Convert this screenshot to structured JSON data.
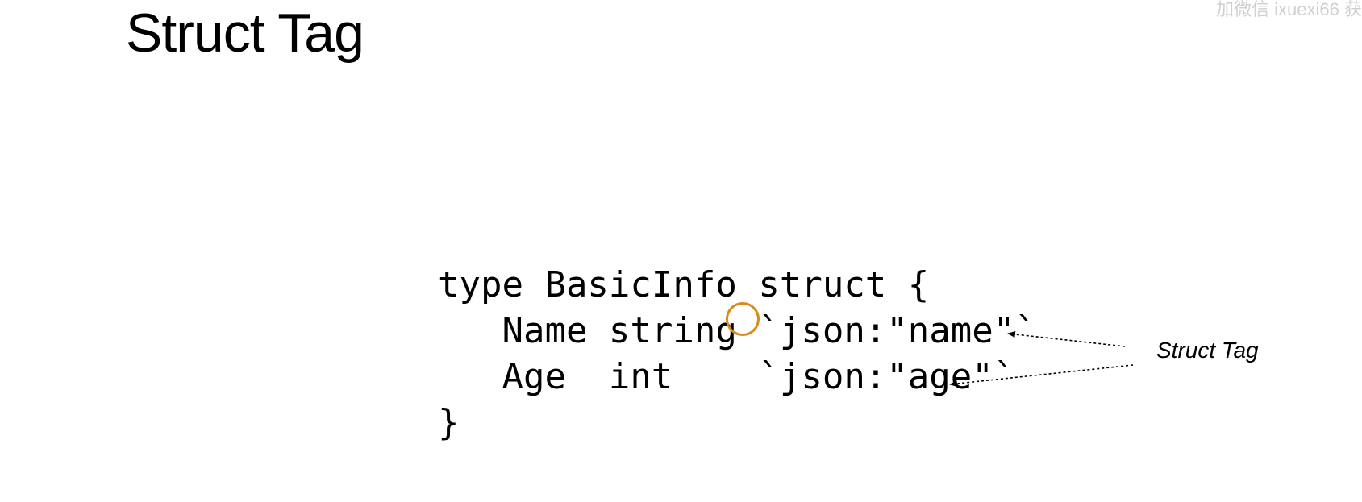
{
  "slide": {
    "title": "Struct Tag",
    "watermark": "加微信 ixuexi66 获"
  },
  "code": {
    "lines": [
      "type BasicInfo struct {",
      "   Name string `json:\"name\"`",
      "   Age  int    `json:\"age\"`",
      "}"
    ]
  },
  "annotation": {
    "label": "Struct Tag"
  },
  "colors": {
    "background": "#ffffff",
    "text": "#000000",
    "cursor_highlight": "#d98a1c",
    "watermark": "#d0d0d0"
  }
}
